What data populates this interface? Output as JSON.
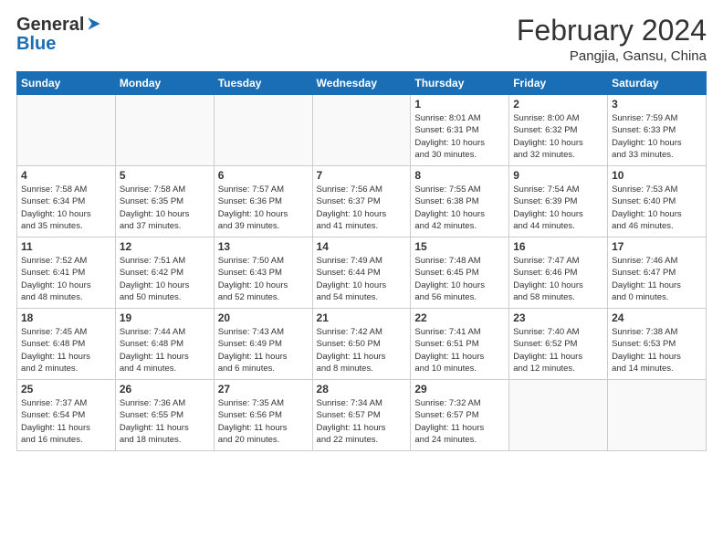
{
  "header": {
    "logo_line1": "General",
    "logo_line2": "Blue",
    "month_year": "February 2024",
    "location": "Pangjia, Gansu, China"
  },
  "weekdays": [
    "Sunday",
    "Monday",
    "Tuesday",
    "Wednesday",
    "Thursday",
    "Friday",
    "Saturday"
  ],
  "weeks": [
    [
      {
        "day": "",
        "info": ""
      },
      {
        "day": "",
        "info": ""
      },
      {
        "day": "",
        "info": ""
      },
      {
        "day": "",
        "info": ""
      },
      {
        "day": "1",
        "info": "Sunrise: 8:01 AM\nSunset: 6:31 PM\nDaylight: 10 hours\nand 30 minutes."
      },
      {
        "day": "2",
        "info": "Sunrise: 8:00 AM\nSunset: 6:32 PM\nDaylight: 10 hours\nand 32 minutes."
      },
      {
        "day": "3",
        "info": "Sunrise: 7:59 AM\nSunset: 6:33 PM\nDaylight: 10 hours\nand 33 minutes."
      }
    ],
    [
      {
        "day": "4",
        "info": "Sunrise: 7:58 AM\nSunset: 6:34 PM\nDaylight: 10 hours\nand 35 minutes."
      },
      {
        "day": "5",
        "info": "Sunrise: 7:58 AM\nSunset: 6:35 PM\nDaylight: 10 hours\nand 37 minutes."
      },
      {
        "day": "6",
        "info": "Sunrise: 7:57 AM\nSunset: 6:36 PM\nDaylight: 10 hours\nand 39 minutes."
      },
      {
        "day": "7",
        "info": "Sunrise: 7:56 AM\nSunset: 6:37 PM\nDaylight: 10 hours\nand 41 minutes."
      },
      {
        "day": "8",
        "info": "Sunrise: 7:55 AM\nSunset: 6:38 PM\nDaylight: 10 hours\nand 42 minutes."
      },
      {
        "day": "9",
        "info": "Sunrise: 7:54 AM\nSunset: 6:39 PM\nDaylight: 10 hours\nand 44 minutes."
      },
      {
        "day": "10",
        "info": "Sunrise: 7:53 AM\nSunset: 6:40 PM\nDaylight: 10 hours\nand 46 minutes."
      }
    ],
    [
      {
        "day": "11",
        "info": "Sunrise: 7:52 AM\nSunset: 6:41 PM\nDaylight: 10 hours\nand 48 minutes."
      },
      {
        "day": "12",
        "info": "Sunrise: 7:51 AM\nSunset: 6:42 PM\nDaylight: 10 hours\nand 50 minutes."
      },
      {
        "day": "13",
        "info": "Sunrise: 7:50 AM\nSunset: 6:43 PM\nDaylight: 10 hours\nand 52 minutes."
      },
      {
        "day": "14",
        "info": "Sunrise: 7:49 AM\nSunset: 6:44 PM\nDaylight: 10 hours\nand 54 minutes."
      },
      {
        "day": "15",
        "info": "Sunrise: 7:48 AM\nSunset: 6:45 PM\nDaylight: 10 hours\nand 56 minutes."
      },
      {
        "day": "16",
        "info": "Sunrise: 7:47 AM\nSunset: 6:46 PM\nDaylight: 10 hours\nand 58 minutes."
      },
      {
        "day": "17",
        "info": "Sunrise: 7:46 AM\nSunset: 6:47 PM\nDaylight: 11 hours\nand 0 minutes."
      }
    ],
    [
      {
        "day": "18",
        "info": "Sunrise: 7:45 AM\nSunset: 6:48 PM\nDaylight: 11 hours\nand 2 minutes."
      },
      {
        "day": "19",
        "info": "Sunrise: 7:44 AM\nSunset: 6:48 PM\nDaylight: 11 hours\nand 4 minutes."
      },
      {
        "day": "20",
        "info": "Sunrise: 7:43 AM\nSunset: 6:49 PM\nDaylight: 11 hours\nand 6 minutes."
      },
      {
        "day": "21",
        "info": "Sunrise: 7:42 AM\nSunset: 6:50 PM\nDaylight: 11 hours\nand 8 minutes."
      },
      {
        "day": "22",
        "info": "Sunrise: 7:41 AM\nSunset: 6:51 PM\nDaylight: 11 hours\nand 10 minutes."
      },
      {
        "day": "23",
        "info": "Sunrise: 7:40 AM\nSunset: 6:52 PM\nDaylight: 11 hours\nand 12 minutes."
      },
      {
        "day": "24",
        "info": "Sunrise: 7:38 AM\nSunset: 6:53 PM\nDaylight: 11 hours\nand 14 minutes."
      }
    ],
    [
      {
        "day": "25",
        "info": "Sunrise: 7:37 AM\nSunset: 6:54 PM\nDaylight: 11 hours\nand 16 minutes."
      },
      {
        "day": "26",
        "info": "Sunrise: 7:36 AM\nSunset: 6:55 PM\nDaylight: 11 hours\nand 18 minutes."
      },
      {
        "day": "27",
        "info": "Sunrise: 7:35 AM\nSunset: 6:56 PM\nDaylight: 11 hours\nand 20 minutes."
      },
      {
        "day": "28",
        "info": "Sunrise: 7:34 AM\nSunset: 6:57 PM\nDaylight: 11 hours\nand 22 minutes."
      },
      {
        "day": "29",
        "info": "Sunrise: 7:32 AM\nSunset: 6:57 PM\nDaylight: 11 hours\nand 24 minutes."
      },
      {
        "day": "",
        "info": ""
      },
      {
        "day": "",
        "info": ""
      }
    ]
  ]
}
